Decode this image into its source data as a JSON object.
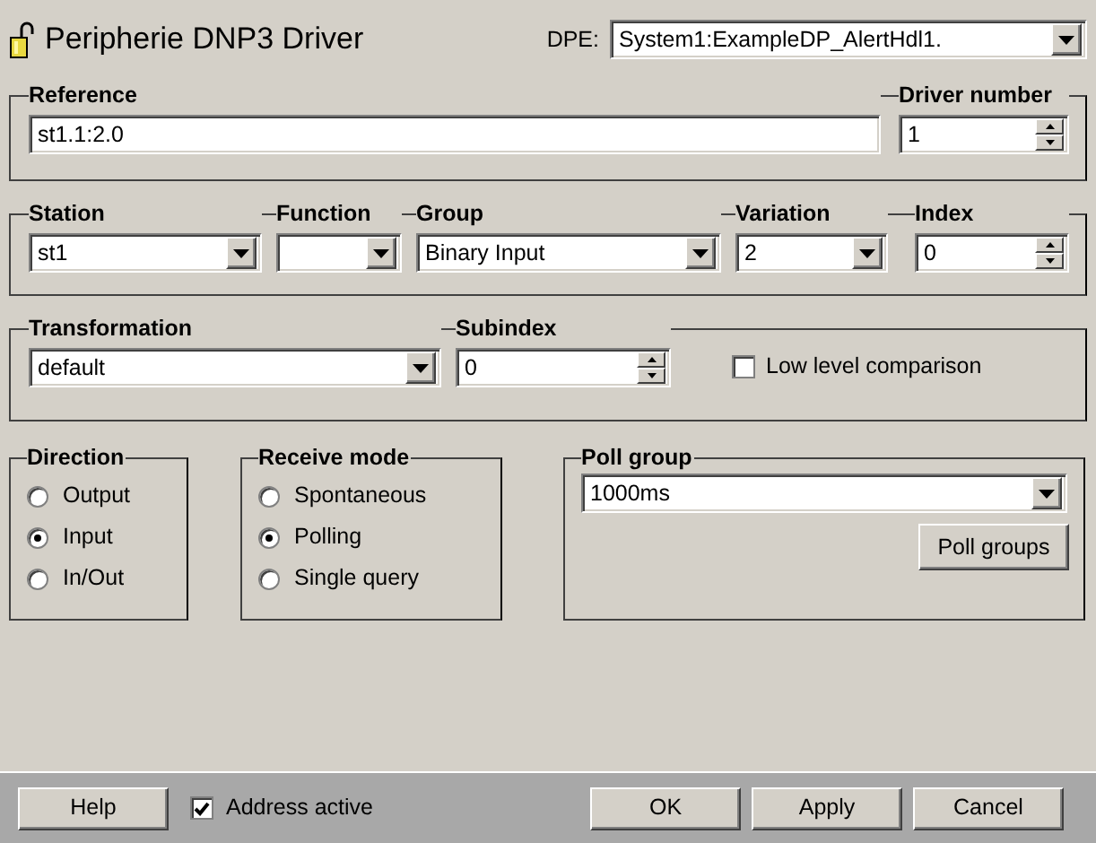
{
  "title": "Peripherie DNP3 Driver",
  "dpe": {
    "label": "DPE:",
    "value": "System1:ExampleDP_AlertHdl1."
  },
  "reference": {
    "label": "Reference",
    "value": "st1.1:2.0"
  },
  "driver_number": {
    "label": "Driver number",
    "value": "1"
  },
  "address_fields": [
    {
      "label": "Station",
      "kind": "dropdown",
      "value": "st1"
    },
    {
      "label": "Function",
      "kind": "dropdown"
    },
    {
      "label": "Group",
      "kind": "dropdown",
      "value": "Binary Input"
    },
    {
      "label": "Variation",
      "kind": "dropdown",
      "value": "2"
    },
    {
      "label": "Index",
      "kind": "spin",
      "value": "0"
    }
  ],
  "transformation": {
    "label": "Transformation",
    "value": "default"
  },
  "subindex": {
    "label": "Subindex",
    "value": "0"
  },
  "low_level_comparison": {
    "label": "Low level comparison",
    "checked": false
  },
  "direction": {
    "label": "Direction",
    "options": [
      {
        "label": "Output",
        "selected": false
      },
      {
        "label": "Input",
        "selected": true
      },
      {
        "label": "In/Out",
        "selected": false
      }
    ]
  },
  "receive_mode": {
    "label": "Receive mode",
    "options": [
      {
        "label": "Spontaneous",
        "selected": false
      },
      {
        "label": "Polling",
        "selected": true
      },
      {
        "label": "Single query",
        "selected": false
      }
    ]
  },
  "poll_group": {
    "label": "Poll group",
    "value": "1000ms",
    "button": "Poll groups"
  },
  "footer": {
    "help": "Help",
    "address_active": {
      "label": "Address active",
      "checked": true
    },
    "buttons": [
      "OK",
      "Apply",
      "Cancel"
    ]
  }
}
